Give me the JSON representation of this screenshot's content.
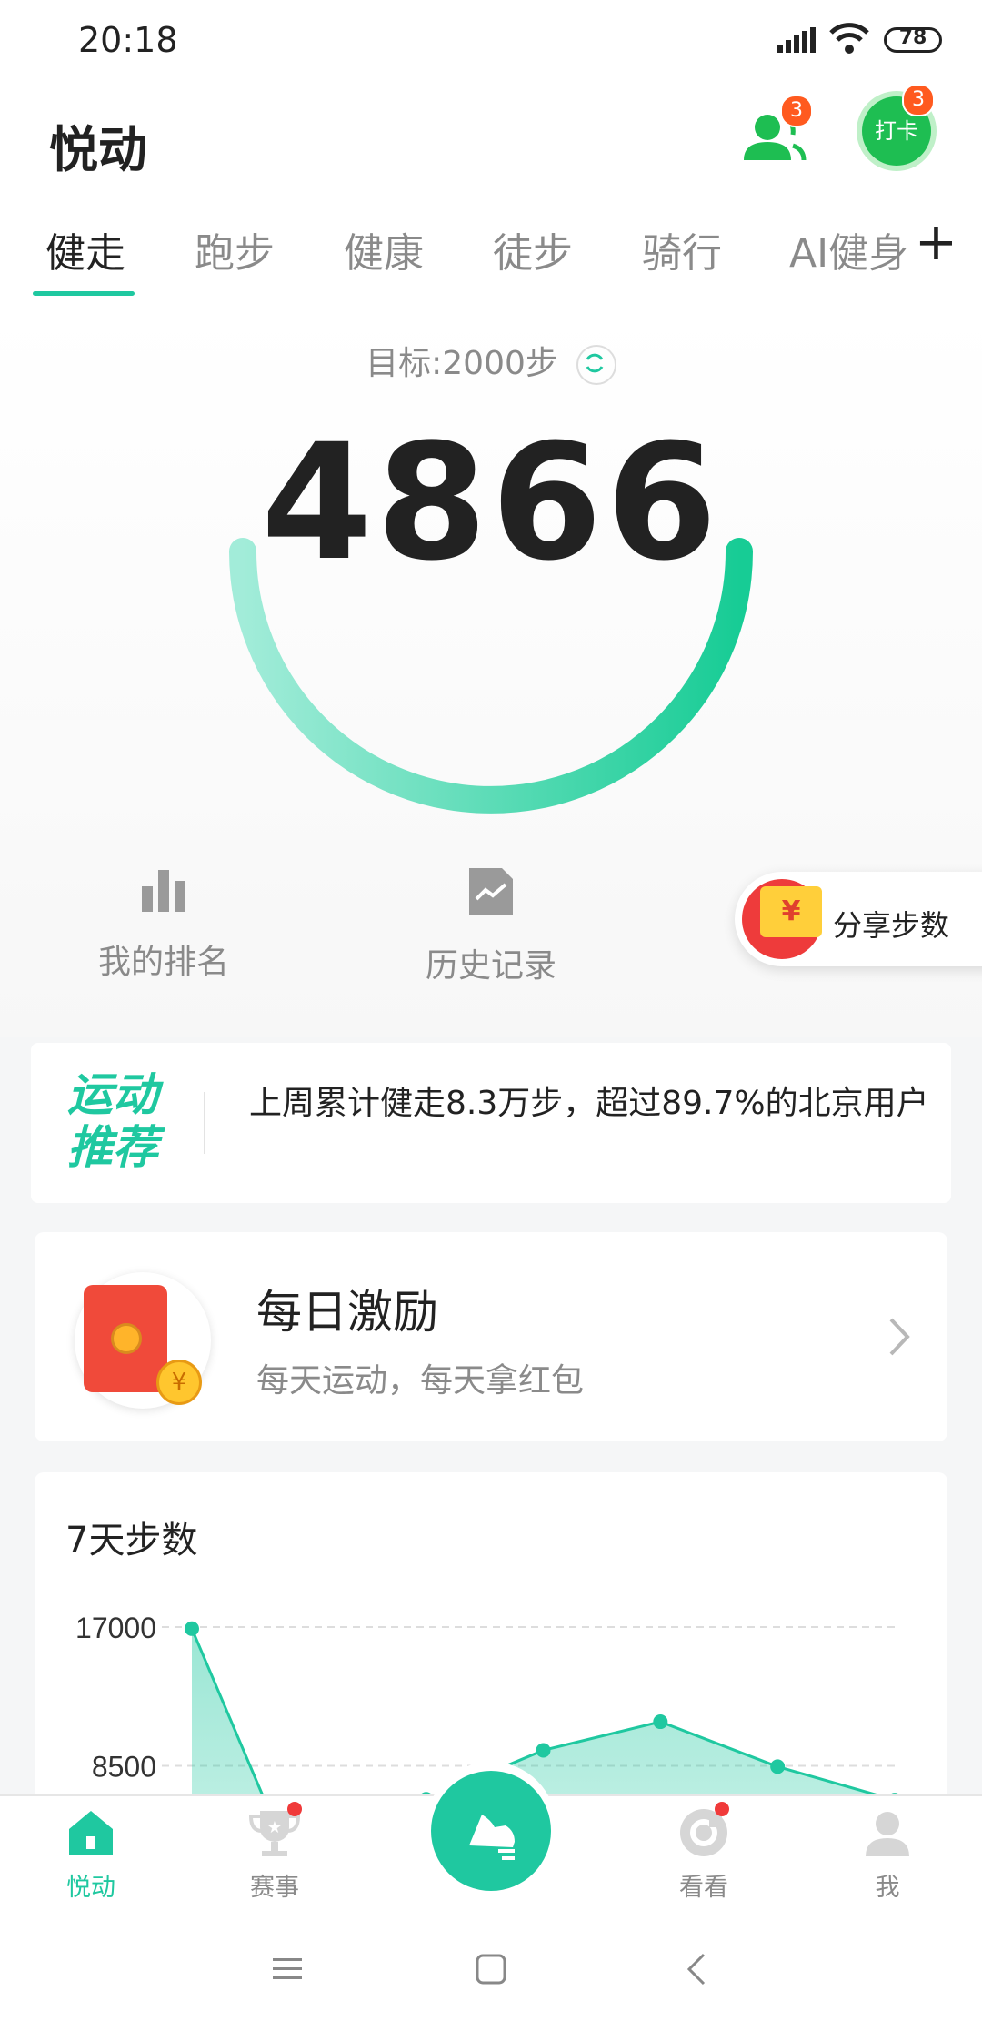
{
  "status_bar": {
    "time": "20:18",
    "battery": "78"
  },
  "header": {
    "title": "悦动",
    "friends_badge": "3",
    "checkin_label": "打卡",
    "checkin_badge": "3"
  },
  "tabs": [
    {
      "label": "健走",
      "active": true
    },
    {
      "label": "跑步"
    },
    {
      "label": "健康"
    },
    {
      "label": "徒步"
    },
    {
      "label": "骑行"
    },
    {
      "label": "AI健身"
    }
  ],
  "tab_add_label": "+",
  "hero": {
    "goal": "目标:2000步",
    "steps": "4866",
    "links": {
      "ranking": "我的排名",
      "history": "历史记录"
    },
    "share_label": "分享步数",
    "share_icon": "¥"
  },
  "recommend": {
    "tag": "运动推荐",
    "text": "上周累计健走8.3万步，超过89.7%的北京用户"
  },
  "reward": {
    "title": "每日激励",
    "subtitle": "每天运动，每天拿红包",
    "coin": "¥"
  },
  "chart_data": {
    "type": "area",
    "title": "7天步数",
    "y_ticks": [
      "17000",
      "8500"
    ],
    "ylim": [
      0,
      17000
    ],
    "series": [
      {
        "values": [
          16900,
          0,
          6450,
          9450,
          11200,
          8450,
          6400
        ]
      }
    ],
    "color": "#1fc8a0",
    "grid": true
  },
  "bottom_nav": [
    {
      "label": "悦动",
      "icon": "home-icon",
      "active": true
    },
    {
      "label": "赛事",
      "icon": "trophy-icon"
    },
    {
      "label": "",
      "icon": "running-shoe-icon"
    },
    {
      "label": "看看",
      "icon": "compass-icon"
    },
    {
      "label": "我",
      "icon": "profile-icon"
    }
  ],
  "colors": {
    "accent": "#1fc8a0",
    "badge": "#ff5a1f",
    "checkin": "#1ebe52"
  }
}
